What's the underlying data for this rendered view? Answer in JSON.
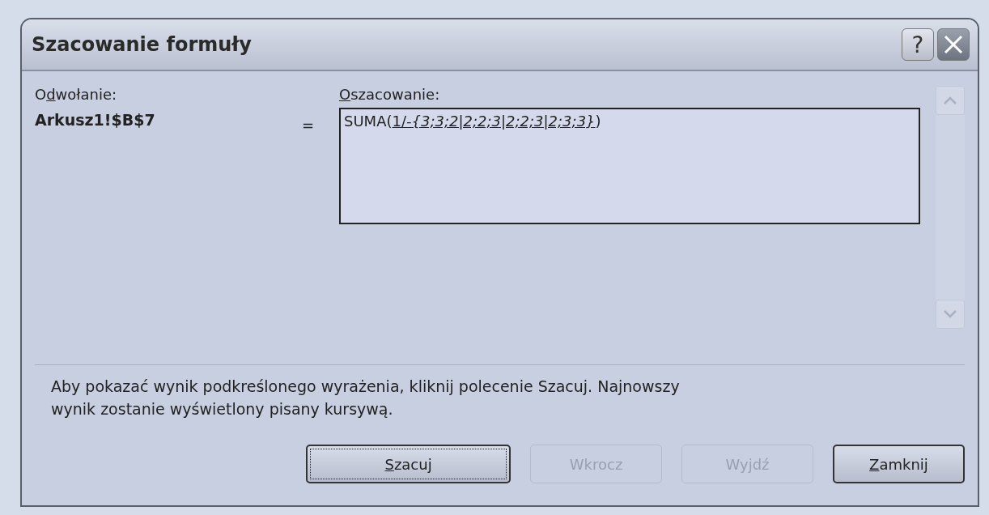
{
  "window": {
    "title": "Szacowanie formuły",
    "help_button": "?"
  },
  "reference": {
    "label": {
      "before": "O",
      "key": "d",
      "after": "wołanie:"
    },
    "value": "Arkusz1!$B$7",
    "equals": "="
  },
  "evaluation": {
    "label": {
      "key": "O",
      "after": "szacowanie:"
    },
    "formula": {
      "prefix": "SUMA(",
      "underlined_parts": [
        {
          "text": "1/",
          "italic": false
        },
        {
          "text": "-{3;3;2|2;2;3|2;2;3|2;3;3}",
          "italic": true
        }
      ],
      "suffix": ")"
    }
  },
  "help_text": "Aby pokazać wynik podkreślonego wyrażenia, kliknij polecenie Szacuj. Najnowszy wynik zostanie wyświetlony pisany kursywą.",
  "buttons": [
    {
      "key": "S",
      "after": "zacuj",
      "disabled": false,
      "focused": true
    },
    {
      "before": "Wkrocz",
      "disabled": true,
      "focused": false
    },
    {
      "before": "Wyjdź",
      "disabled": true,
      "focused": false
    },
    {
      "key": "Z",
      "after": "amknij",
      "disabled": false,
      "focused": false
    }
  ]
}
